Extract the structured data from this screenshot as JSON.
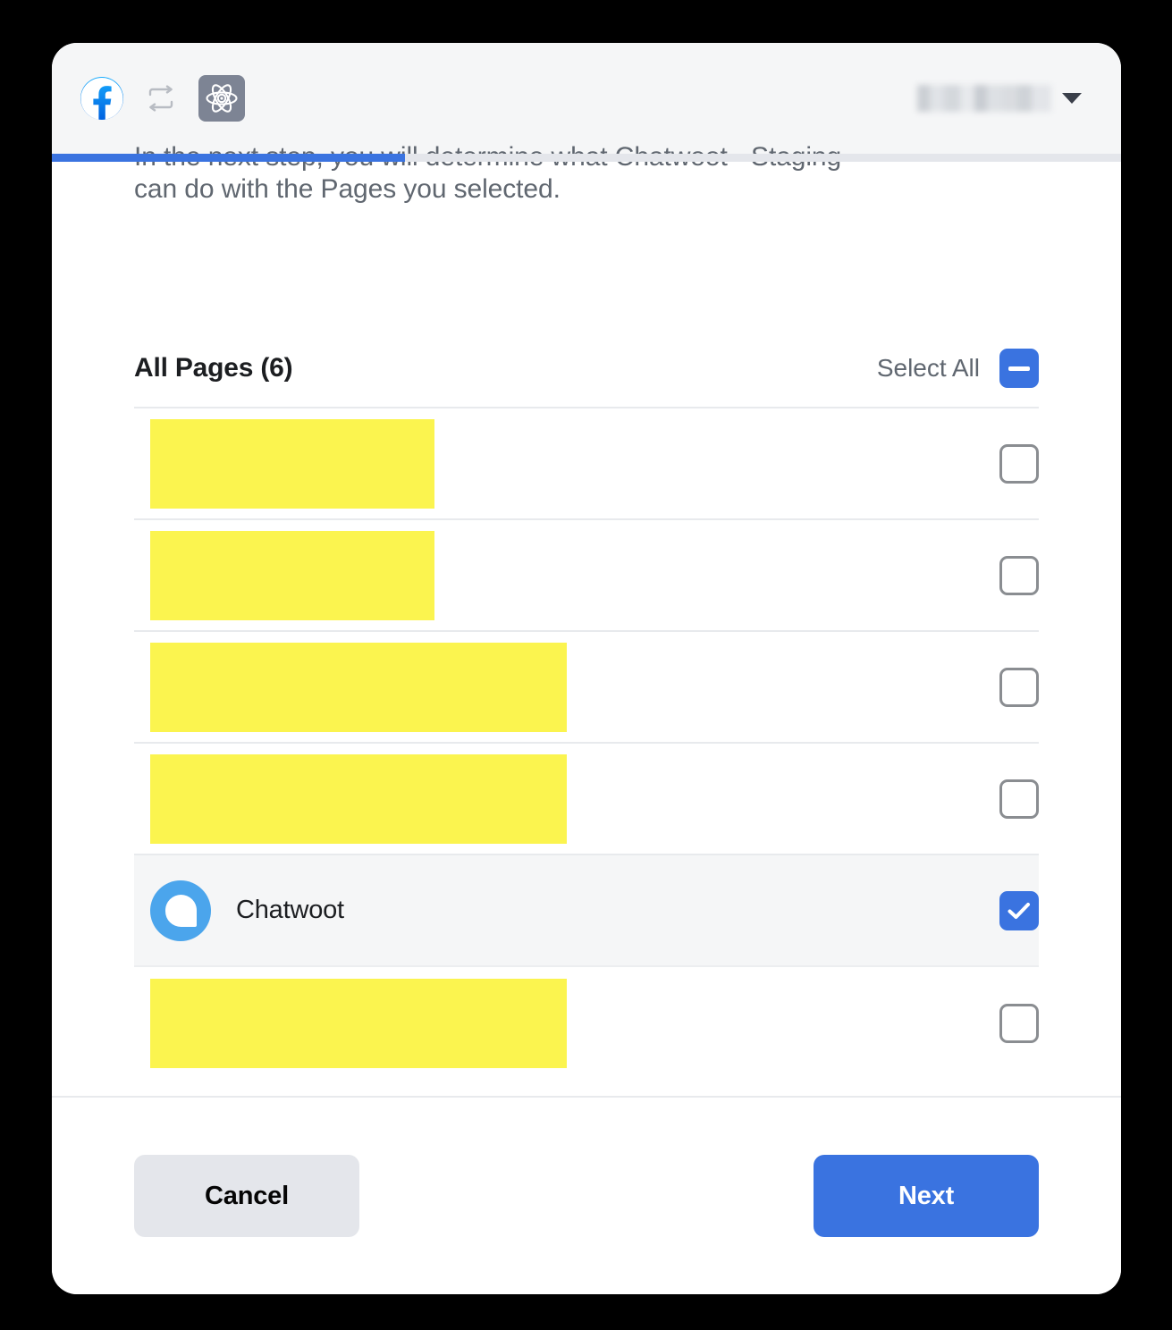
{
  "toolbar": {
    "facebook_icon": "facebook-logo-icon",
    "repeat_icon": "repeat-loop-icon",
    "react_icon": "react-atom-icon",
    "user_name_redacted": "",
    "caret_icon": "chevron-down-icon"
  },
  "progress": {
    "percent": 33,
    "fill_color": "#3a73e0",
    "track_color": "#e4e6eb"
  },
  "intro": {
    "line1": "In the next step, you will determine what Chatwoot - Staging",
    "line2": "can do with the Pages you selected."
  },
  "list": {
    "title": "All Pages (6)",
    "select_all_label": "Select All",
    "select_all_state": "indeterminate",
    "rows": [
      {
        "name": "",
        "redacted": true,
        "redaction_width": 318,
        "checked": false,
        "selected": false,
        "avatar": null
      },
      {
        "name": "",
        "redacted": true,
        "redaction_width": 318,
        "checked": false,
        "selected": false,
        "avatar": null
      },
      {
        "name": "",
        "redacted": true,
        "redaction_width": 466,
        "checked": false,
        "selected": false,
        "avatar": null
      },
      {
        "name": "",
        "redacted": true,
        "redaction_width": 466,
        "checked": false,
        "selected": false,
        "avatar": null
      },
      {
        "name": "Chatwoot",
        "redacted": false,
        "redaction_width": 0,
        "checked": true,
        "selected": true,
        "avatar": "chatwoot-logo-icon"
      },
      {
        "name": "",
        "redacted": true,
        "redaction_width": 466,
        "checked": false,
        "selected": false,
        "avatar": null
      }
    ]
  },
  "footer": {
    "cancel_label": "Cancel",
    "next_label": "Next"
  },
  "colors": {
    "accent": "#3a73e0",
    "redaction": "#fbf44f",
    "chatwoot_blue": "#4ba5ec",
    "toolbar_bg": "#f5f6f7",
    "page_bg": "#000000"
  }
}
